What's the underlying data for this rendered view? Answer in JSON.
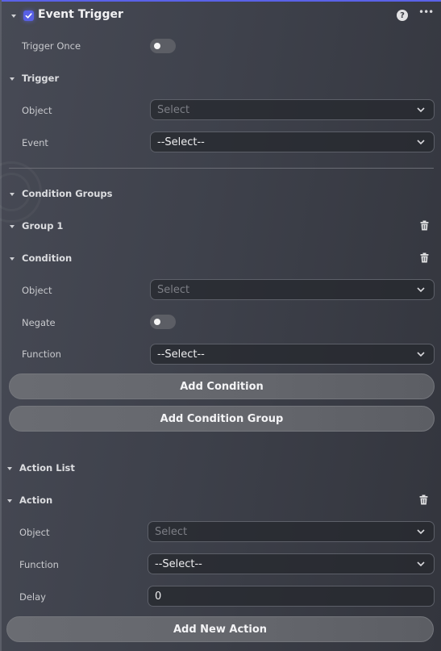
{
  "header": {
    "title": "Event Trigger",
    "enabled_checked": true,
    "help_icon": "question-circle-icon",
    "more_icon": "ellipsis-icon"
  },
  "trigger_once": {
    "label": "Trigger Once",
    "value": false
  },
  "trigger": {
    "section_title": "Trigger",
    "object": {
      "label": "Object",
      "placeholder": "Select",
      "value": ""
    },
    "event": {
      "label": "Event",
      "value": "--Select--"
    }
  },
  "condition_groups": {
    "section_title": "Condition Groups",
    "group": {
      "title": "Group 1",
      "condition": {
        "title": "Condition",
        "object": {
          "label": "Object",
          "placeholder": "Select",
          "value": ""
        },
        "negate": {
          "label": "Negate",
          "value": false
        },
        "function": {
          "label": "Function",
          "value": "--Select--"
        }
      }
    },
    "add_condition_label": "Add Condition",
    "add_condition_group_label": "Add Condition Group"
  },
  "action_list": {
    "section_title": "Action List",
    "action": {
      "title": "Action",
      "object": {
        "label": "Object",
        "placeholder": "Select",
        "value": ""
      },
      "function": {
        "label": "Function",
        "value": "--Select--"
      },
      "delay": {
        "label": "Delay",
        "value": "0"
      }
    },
    "add_action_label": "Add New Action"
  },
  "colors": {
    "accent": "#5a62e8",
    "button_bg": "#66686e",
    "panel_bg": "#3e414b"
  }
}
